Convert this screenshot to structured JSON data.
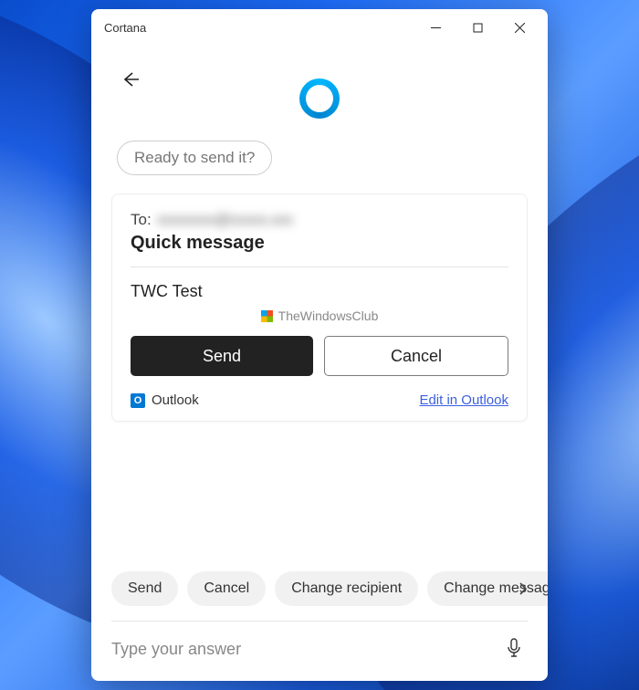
{
  "window": {
    "title": "Cortana"
  },
  "prompt": "Ready to send it?",
  "card": {
    "to_label": "To:",
    "to_value": "xxxxxxxx@xxxxx.xxx",
    "subject": "Quick message",
    "body": "TWC Test",
    "watermark": "TheWindowsClub",
    "send": "Send",
    "cancel": "Cancel",
    "outlook_label": "Outlook",
    "edit_link": "Edit in Outlook"
  },
  "chips": {
    "c0": "Send",
    "c1": "Cancel",
    "c2": "Change recipient",
    "c3": "Change message"
  },
  "input": {
    "placeholder": "Type your answer"
  }
}
